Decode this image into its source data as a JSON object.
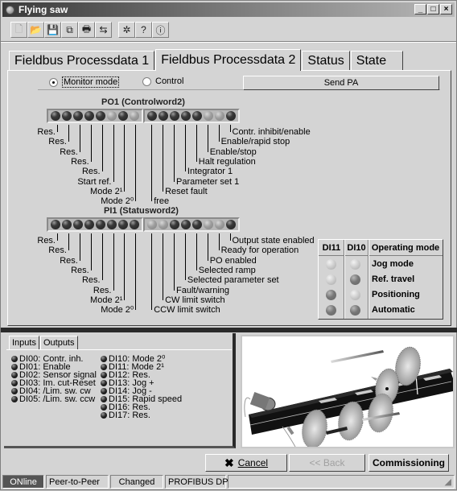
{
  "window": {
    "title": "Flying saw",
    "controls": [
      "minimize",
      "maximize",
      "close"
    ],
    "control_glyphs": [
      "_",
      "□",
      "×"
    ]
  },
  "toolbar": {
    "groups": [
      [
        {
          "icon": "new-document-icon",
          "glyph": "🗋",
          "enabled": false
        },
        {
          "icon": "open-folder-icon",
          "glyph": "📂",
          "enabled": false
        },
        {
          "icon": "save-icon",
          "glyph": "💾",
          "enabled": true
        },
        {
          "icon": "save-as-icon",
          "glyph": "⧉",
          "enabled": true
        },
        {
          "icon": "print-icon",
          "glyph": "🖶",
          "enabled": true
        },
        {
          "icon": "transfer-icon",
          "glyph": "⇆",
          "enabled": true
        }
      ],
      [
        {
          "icon": "debug-bug-icon",
          "glyph": "✲",
          "enabled": true
        },
        {
          "icon": "help-icon",
          "glyph": "?",
          "enabled": true
        },
        {
          "icon": "info-icon",
          "glyph": "ⓘ",
          "enabled": true
        }
      ]
    ]
  },
  "tabs": [
    {
      "label": "Fieldbus Processdata 1",
      "active": false
    },
    {
      "label": "Fieldbus Processdata 2",
      "active": true
    },
    {
      "label": "Status",
      "active": false
    },
    {
      "label": "State",
      "active": false
    }
  ],
  "mode": {
    "monitor_label": "Monitor mode",
    "control_label": "Control",
    "selected": "monitor",
    "send_button": "Send PA"
  },
  "po1": {
    "title": "PO1 (Controlword2)",
    "bits_high_to_low": [
      1,
      1,
      1,
      1,
      1,
      0,
      1,
      0,
      1,
      1,
      1,
      1,
      1,
      0,
      0,
      1
    ],
    "labels_high_to_low": [
      "Res.",
      "Res.",
      "Res.",
      "Res.",
      "Res.",
      "Start ref.",
      "Mode 2¹",
      "Mode 2⁰",
      "free",
      "Reset fault",
      "Parameter set 1",
      "Integrator 1",
      "Halt regulation",
      "Enable/stop",
      "Enable/rapid stop",
      "Contr. inhibit/enable"
    ]
  },
  "pi1": {
    "title": "PI1 (Statusword2)",
    "bits_high_to_low": [
      1,
      1,
      1,
      1,
      1,
      1,
      1,
      1,
      0,
      0,
      1,
      1,
      1,
      0,
      0,
      1
    ],
    "labels_high_to_low": [
      "Res.",
      "Res.",
      "Res.",
      "Res.",
      "Res.",
      "Res.",
      "Mode 2¹",
      "Mode 2⁰",
      "CCW limit switch",
      "CW limit switch",
      "Fault/warning",
      "Selected parameter set",
      "Selected ramp",
      "PO enabled",
      "Ready for operation",
      "Output state enabled"
    ]
  },
  "operating_mode_table": {
    "headers": [
      "DI11",
      "DI10",
      "Operating mode"
    ],
    "rows": [
      {
        "di11": 0,
        "di10": 0,
        "mode": "Jog mode"
      },
      {
        "di11": 0,
        "di10": 1,
        "mode": "Ref. travel"
      },
      {
        "di11": 1,
        "di10": 0,
        "mode": "Positioning"
      },
      {
        "di11": 1,
        "di10": 1,
        "mode": "Automatic"
      }
    ]
  },
  "io_panel": {
    "tabs": [
      {
        "label": "Inputs",
        "active": true
      },
      {
        "label": "Outputs",
        "active": false
      }
    ],
    "inputs_col1": [
      "DI00: Contr. inh.",
      "DI01: Enable",
      "DI02: Sensor signal",
      "DI03: Im. cut-Reset",
      "DI04: /Lim. sw. cw",
      "DI05: /Lim. sw. ccw"
    ],
    "inputs_col2": [
      "DI10: Mode 2⁰",
      "DI11: Mode 2¹",
      "DI12: Res.",
      "DI13: Jog +",
      "DI14: Jog -",
      "DI15: Rapid speed",
      "DI16: Res.",
      "DI17: Res."
    ]
  },
  "illustration": {
    "description": "Flying saw machine illustration: black profile bar on conveyor with circular saw blades and motion arrows"
  },
  "buttons": {
    "cancel": "Cancel",
    "cancel_icon": "✖",
    "back": "<< Back",
    "commissioning": "Commissioning"
  },
  "statusbar": {
    "online": "ONline",
    "connection": "Peer-to-Peer",
    "changed": "Changed",
    "bus": "PROFIBUS DP",
    "empty": ""
  }
}
